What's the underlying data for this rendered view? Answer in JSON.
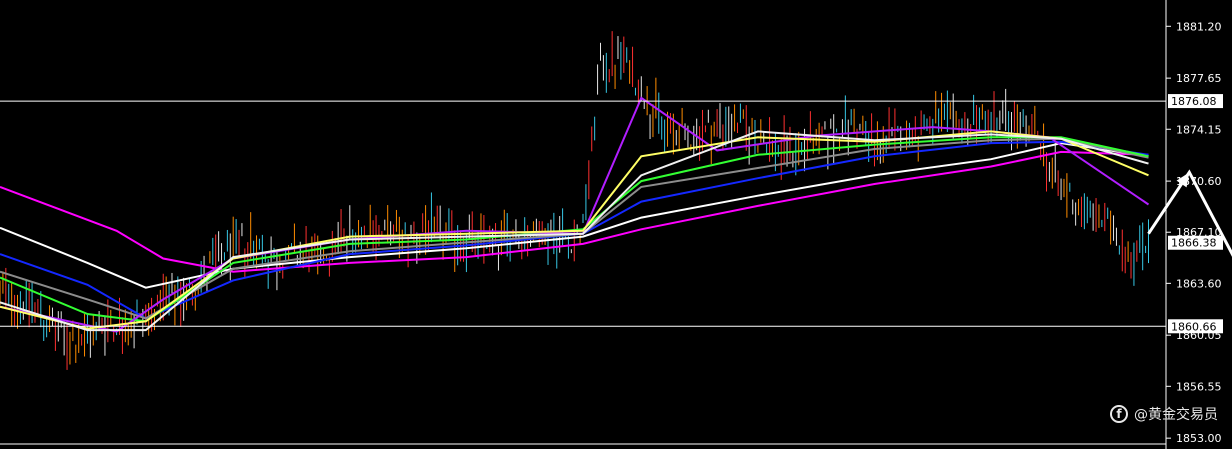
{
  "chart_data": {
    "type": "line",
    "title": "",
    "xlabel": "",
    "ylabel": "",
    "ylim": [
      1852.6,
      1883.0
    ],
    "y_ticks": [
      1881.2,
      1877.65,
      1874.15,
      1870.6,
      1867.1,
      1863.6,
      1860.05,
      1856.55,
      1853.0
    ],
    "y_tick_labels": [
      "1881.20",
      "1877.65",
      "1874.15",
      "1870.60",
      "1867.10",
      "1863.60",
      "1860.05",
      "1856.55",
      "1853.00"
    ],
    "grid": false,
    "legend": "none",
    "horizontal_levels": [
      {
        "value": 1876.08,
        "label": "1876.08",
        "color": "#ffffff"
      },
      {
        "value": 1860.66,
        "label": "1860.66",
        "color": "#ffffff"
      }
    ],
    "current_price": {
      "value": 1866.38,
      "label": "1866.38"
    },
    "price_path": [
      [
        0,
        1863.0
      ],
      [
        6,
        1862.0
      ],
      [
        10,
        1860.0
      ],
      [
        14,
        1859.5
      ],
      [
        18,
        1861.0
      ],
      [
        23,
        1860.8
      ],
      [
        27,
        1862.0
      ],
      [
        31,
        1862.5
      ],
      [
        35,
        1864.2
      ],
      [
        39,
        1865.8
      ],
      [
        43,
        1866.5
      ],
      [
        47,
        1865.0
      ],
      [
        51,
        1865.7
      ],
      [
        55,
        1865.3
      ],
      [
        58,
        1866.6
      ],
      [
        62,
        1867.4
      ],
      [
        66,
        1867.0
      ],
      [
        70,
        1866.8
      ],
      [
        74,
        1867.3
      ],
      [
        78,
        1866.6
      ],
      [
        82,
        1866.4
      ],
      [
        86,
        1866.7
      ],
      [
        90,
        1866.9
      ],
      [
        94,
        1867.0
      ],
      [
        98,
        1866.6
      ],
      [
        100,
        1867.2
      ],
      [
        103,
        1878.6
      ],
      [
        107,
        1878.9
      ],
      [
        111,
        1876.2
      ],
      [
        114,
        1874.2
      ],
      [
        118,
        1873.6
      ],
      [
        122,
        1874.2
      ],
      [
        126,
        1874.6
      ],
      [
        130,
        1873.6
      ],
      [
        134,
        1872.6
      ],
      [
        138,
        1873.1
      ],
      [
        142,
        1873.6
      ],
      [
        146,
        1874.6
      ],
      [
        150,
        1873.1
      ],
      [
        154,
        1873.6
      ],
      [
        158,
        1874.2
      ],
      [
        162,
        1874.6
      ],
      [
        166,
        1874.4
      ],
      [
        170,
        1875.1
      ],
      [
        174,
        1874.6
      ],
      [
        178,
        1873.6
      ],
      [
        182,
        1870.1
      ],
      [
        186,
        1868.6
      ],
      [
        190,
        1867.6
      ],
      [
        194,
        1865.6
      ],
      [
        197,
        1866.6
      ]
    ],
    "series": [
      {
        "color": "#ff00ff",
        "values": [
          [
            0,
            1870.2
          ],
          [
            20,
            1867.2
          ],
          [
            28,
            1865.3
          ],
          [
            40,
            1864.4
          ],
          [
            60,
            1865.0
          ],
          [
            80,
            1865.4
          ],
          [
            100,
            1866.3
          ],
          [
            110,
            1867.3
          ],
          [
            130,
            1868.9
          ],
          [
            150,
            1870.4
          ],
          [
            170,
            1871.6
          ],
          [
            182,
            1872.6
          ],
          [
            197,
            1872.4
          ]
        ]
      },
      {
        "color": "#ffffff",
        "values": [
          [
            0,
            1867.4
          ],
          [
            15,
            1865.0
          ],
          [
            25,
            1863.3
          ],
          [
            40,
            1864.6
          ],
          [
            60,
            1865.4
          ],
          [
            80,
            1866.0
          ],
          [
            100,
            1866.8
          ],
          [
            110,
            1868.1
          ],
          [
            130,
            1869.6
          ],
          [
            150,
            1871.0
          ],
          [
            170,
            1872.1
          ],
          [
            182,
            1873.2
          ],
          [
            197,
            1872.3
          ]
        ]
      },
      {
        "color": "#1428ff",
        "values": [
          [
            0,
            1865.6
          ],
          [
            15,
            1863.5
          ],
          [
            25,
            1861.2
          ],
          [
            40,
            1863.8
          ],
          [
            60,
            1865.6
          ],
          [
            80,
            1866.2
          ],
          [
            100,
            1867.0
          ],
          [
            110,
            1869.2
          ],
          [
            130,
            1870.8
          ],
          [
            150,
            1872.3
          ],
          [
            170,
            1873.2
          ],
          [
            182,
            1873.3
          ],
          [
            197,
            1872.4
          ]
        ]
      },
      {
        "color": "#8c8c8c",
        "values": [
          [
            0,
            1864.4
          ],
          [
            15,
            1862.5
          ],
          [
            25,
            1861.2
          ],
          [
            40,
            1864.6
          ],
          [
            60,
            1865.8
          ],
          [
            80,
            1866.4
          ],
          [
            100,
            1867.0
          ],
          [
            110,
            1870.2
          ],
          [
            130,
            1871.5
          ],
          [
            150,
            1872.8
          ],
          [
            170,
            1873.4
          ],
          [
            182,
            1873.5
          ],
          [
            197,
            1872.2
          ]
        ]
      },
      {
        "color": "#33ff33",
        "values": [
          [
            0,
            1864.0
          ],
          [
            15,
            1861.5
          ],
          [
            25,
            1861.0
          ],
          [
            40,
            1865.0
          ],
          [
            60,
            1866.3
          ],
          [
            80,
            1866.6
          ],
          [
            100,
            1867.3
          ],
          [
            110,
            1870.6
          ],
          [
            130,
            1872.4
          ],
          [
            150,
            1873.1
          ],
          [
            170,
            1873.6
          ],
          [
            182,
            1873.6
          ],
          [
            197,
            1872.3
          ]
        ]
      },
      {
        "color": "#b21eff",
        "values": [
          [
            0,
            1862.0
          ],
          [
            20,
            1860.3
          ],
          [
            28,
            1862.5
          ],
          [
            40,
            1865.3
          ],
          [
            60,
            1866.6
          ],
          [
            80,
            1867.2
          ],
          [
            100,
            1867.0
          ],
          [
            110,
            1876.3
          ],
          [
            123,
            1872.7
          ],
          [
            140,
            1873.7
          ],
          [
            160,
            1874.3
          ],
          [
            170,
            1874.0
          ],
          [
            180,
            1873.6
          ],
          [
            197,
            1869.0
          ]
        ]
      },
      {
        "color": "#ffff66",
        "values": [
          [
            0,
            1862.0
          ],
          [
            15,
            1860.5
          ],
          [
            25,
            1861.0
          ],
          [
            40,
            1865.3
          ],
          [
            60,
            1866.8
          ],
          [
            80,
            1867.0
          ],
          [
            100,
            1867.2
          ],
          [
            110,
            1872.3
          ],
          [
            130,
            1873.6
          ],
          [
            150,
            1873.3
          ],
          [
            170,
            1874.0
          ],
          [
            182,
            1873.5
          ],
          [
            197,
            1871.0
          ]
        ]
      },
      {
        "color": "#f0f0f0",
        "values": [
          [
            0,
            1862.3
          ],
          [
            15,
            1860.4
          ],
          [
            25,
            1860.4
          ],
          [
            40,
            1865.4
          ],
          [
            60,
            1866.6
          ],
          [
            80,
            1866.8
          ],
          [
            100,
            1867.0
          ],
          [
            110,
            1871.0
          ],
          [
            130,
            1874.0
          ],
          [
            150,
            1873.4
          ],
          [
            170,
            1873.8
          ],
          [
            182,
            1873.5
          ],
          [
            197,
            1871.8
          ]
        ]
      }
    ],
    "annotations": [
      {
        "type": "arrow",
        "color": "#ffffff",
        "points": [
          [
            197,
            1867.0
          ],
          [
            204,
            1871.2
          ],
          [
            214,
            1863.6
          ]
        ]
      }
    ]
  },
  "watermark": {
    "text": "@黄金交易员",
    "logo_glyph": "f"
  }
}
